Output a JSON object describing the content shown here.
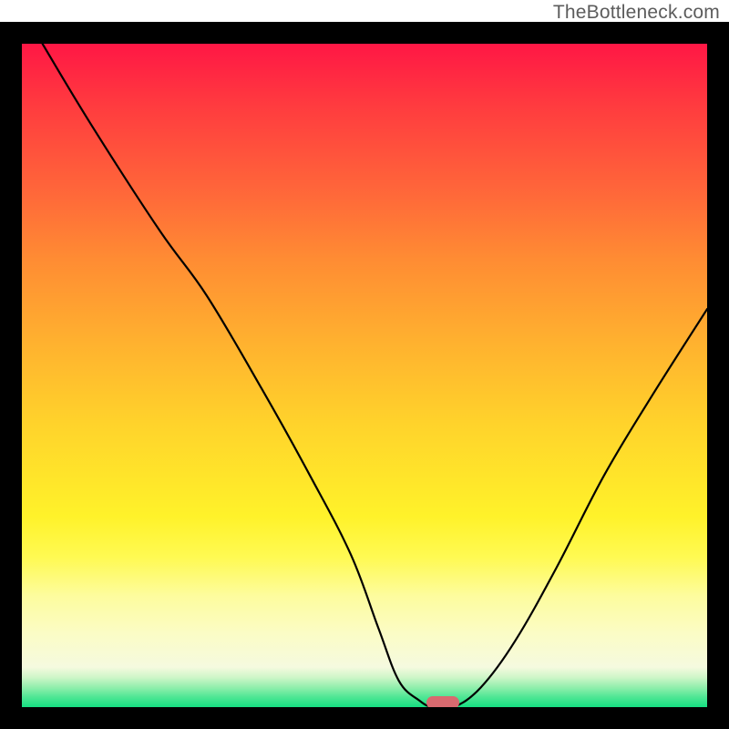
{
  "attribution": "TheBottleneck.com",
  "colors": {
    "frame": "#000000",
    "curve": "#000000",
    "marker": "#d86a6f",
    "gradient_top": "#ff1745",
    "gradient_bottom": "#15df81"
  },
  "chart_data": {
    "type": "line",
    "title": "",
    "xlabel": "",
    "ylabel": "",
    "xlim": [
      0,
      100
    ],
    "ylim": [
      0,
      100
    ],
    "x": [
      3,
      10,
      20,
      27,
      35,
      42,
      48,
      52,
      55,
      58,
      60,
      63,
      67,
      72,
      78,
      85,
      92,
      100
    ],
    "values": [
      100,
      88,
      72,
      62,
      48,
      35,
      23,
      12,
      4,
      1,
      0,
      0,
      3,
      10,
      21,
      35,
      47,
      60
    ],
    "marker": {
      "x": 61.5,
      "y": 0.7
    },
    "grid": false,
    "legend_position": "none"
  }
}
